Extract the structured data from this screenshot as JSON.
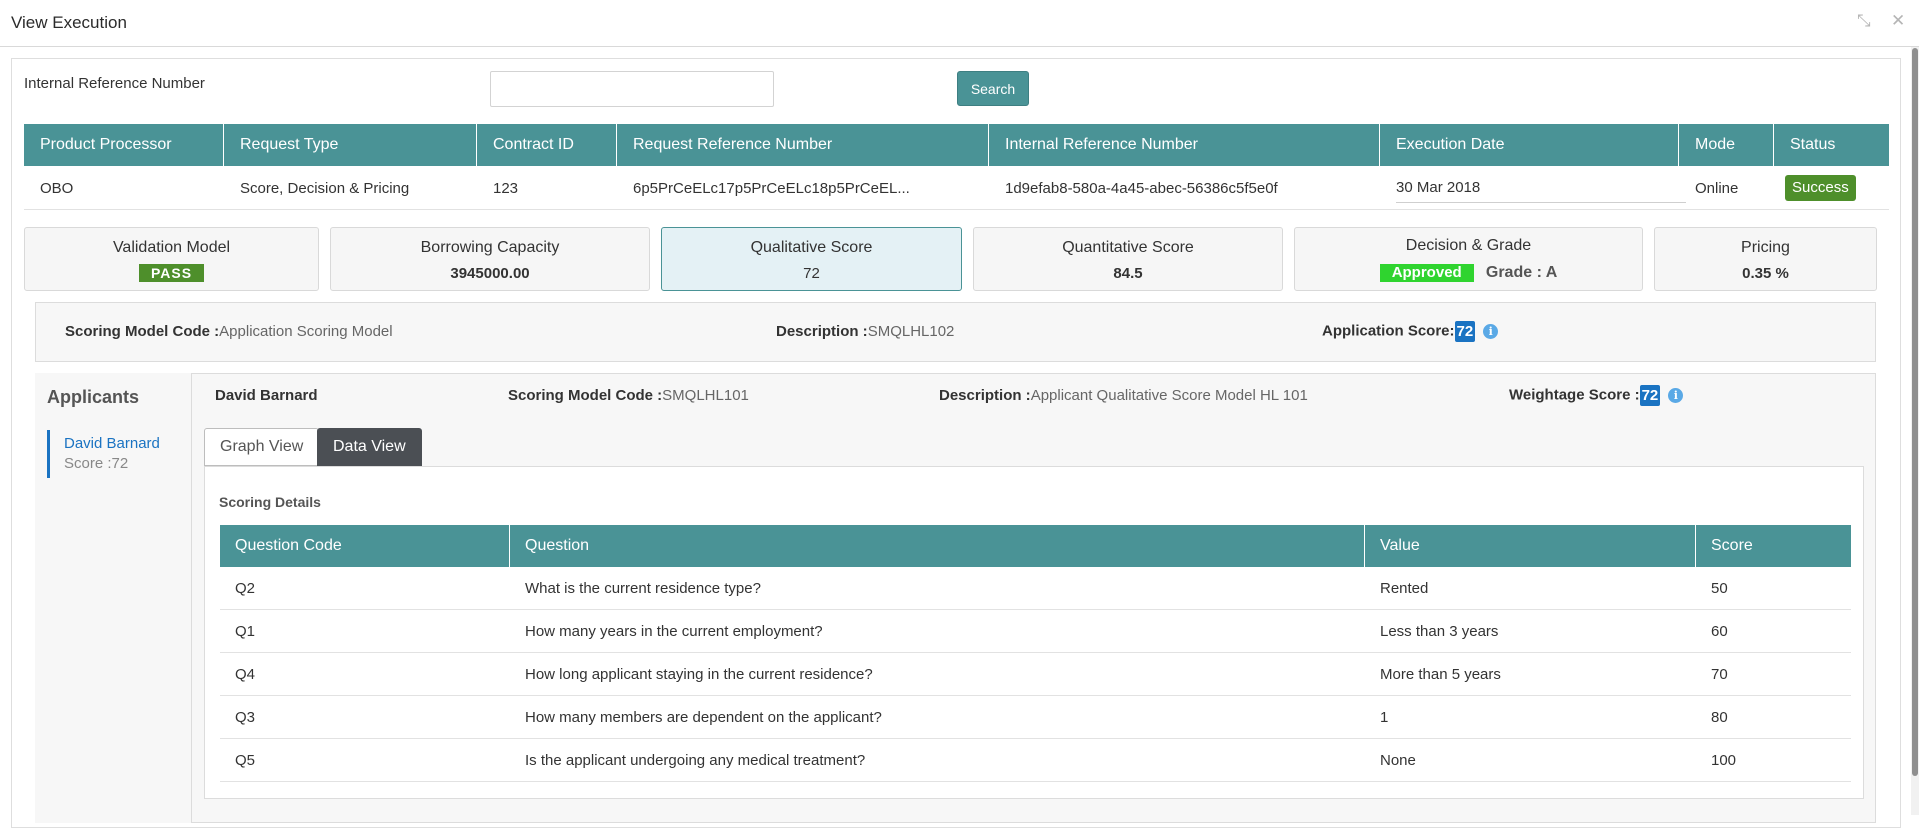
{
  "window": {
    "title": "View Execution"
  },
  "search": {
    "label": "Internal Reference Number",
    "value": "",
    "button_label": "Search"
  },
  "execution_table": {
    "headers": [
      "Product Processor",
      "Request Type",
      "Contract ID",
      "Request Reference Number",
      "Internal Reference Number",
      "Execution Date",
      "Mode",
      "Status"
    ],
    "row": {
      "product_processor": "OBO",
      "request_type": "Score, Decision & Pricing",
      "contract_id": "123",
      "request_reference_number": "6p5PrCeELc17p5PrCeELc18p5PrCeEL...",
      "internal_reference_number": "1d9efab8-580a-4a45-abec-56386c5f5e0f",
      "execution_date": "30 Mar 2018",
      "mode": "Online",
      "status": "Success"
    }
  },
  "cards": {
    "validation": {
      "title": "Validation Model",
      "value": "PASS"
    },
    "borrowing": {
      "title": "Borrowing Capacity",
      "value": "3945000.00"
    },
    "qualitative": {
      "title": "Qualitative Score",
      "value": "72"
    },
    "quantitative": {
      "title": "Quantitative Score",
      "value": "84.5"
    },
    "decision": {
      "title": "Decision & Grade",
      "value": "Approved",
      "grade": "Grade : A"
    },
    "pricing": {
      "title": "Pricing",
      "value": "0.35 %"
    }
  },
  "scoring_model": {
    "code_label": "Scoring Model Code :",
    "code_value": "Application Scoring Model",
    "desc_label": "Description :",
    "desc_value": "SMQLHL102",
    "app_score_label": "Application Score:",
    "app_score_value": "72"
  },
  "applicants": {
    "heading": "Applicants",
    "items": [
      {
        "name": "David Barnard",
        "score": "Score :72"
      }
    ]
  },
  "applicant_detail": {
    "name": "David Barnard",
    "code_label": "Scoring Model Code :",
    "code_value": "SMQLHL101",
    "desc_label": "Description :",
    "desc_value": "Applicant Qualitative Score Model HL 101",
    "weightage_label": "Weightage Score :",
    "weightage_value": "72"
  },
  "tabs": {
    "graph": "Graph View",
    "data": "Data View"
  },
  "scoring_details": {
    "title": "Scoring Details",
    "headers": [
      "Question Code",
      "Question",
      "Value",
      "Score"
    ],
    "rows": [
      {
        "code": "Q2",
        "question": "What is the current residence type?",
        "value": "Rented",
        "score": "50"
      },
      {
        "code": "Q1",
        "question": "How many years in the current employment?",
        "value": "Less than 3 years",
        "score": "60"
      },
      {
        "code": "Q4",
        "question": "How long applicant staying in the current residence?",
        "value": "More than 5 years",
        "score": "70"
      },
      {
        "code": "Q3",
        "question": "How many members are dependent on the applicant?",
        "value": "1",
        "score": "80"
      },
      {
        "code": "Q5",
        "question": "Is the applicant undergoing any medical treatment?",
        "value": "None",
        "score": "100"
      }
    ]
  },
  "colors": {
    "teal_header": "#4a9396",
    "success_green": "#4e8f2b",
    "approved_green": "#2fd42f",
    "link_blue": "#1a73c2"
  }
}
